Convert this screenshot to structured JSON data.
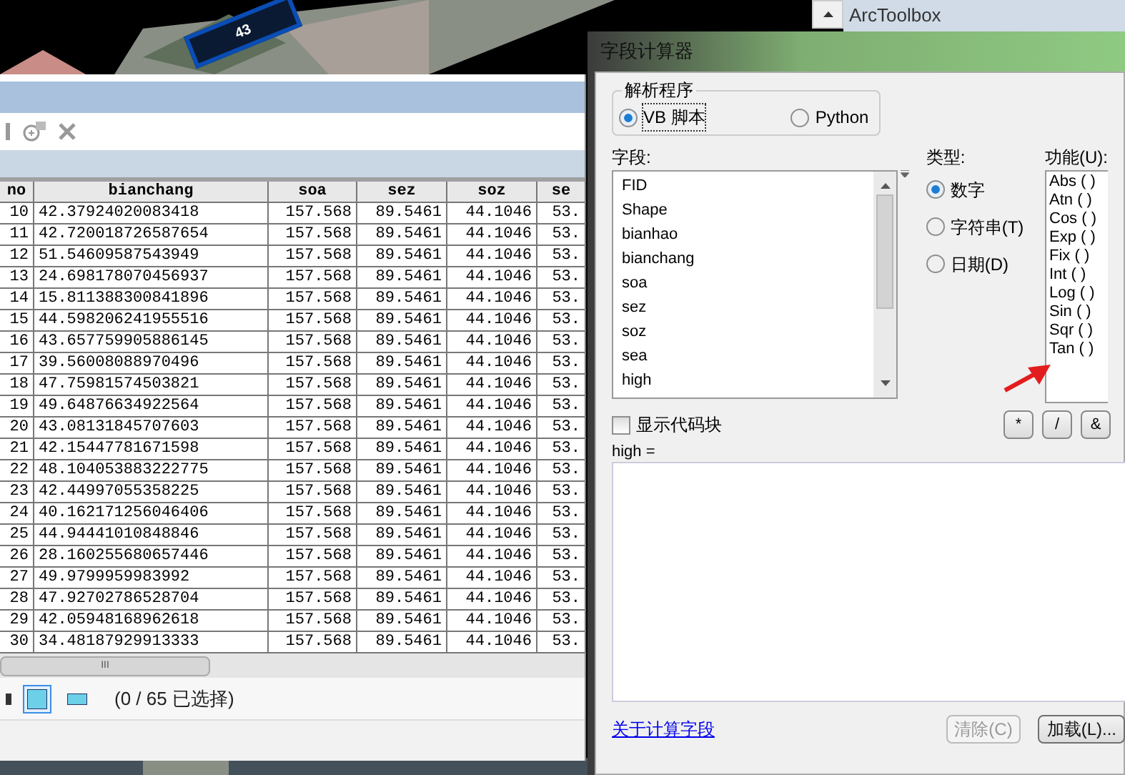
{
  "map_label": "43",
  "toolbox": {
    "title": "ArcToolbox"
  },
  "table": {
    "columns": [
      "no",
      "bianchang",
      "soa",
      "sez",
      "soz",
      "se"
    ],
    "rows": [
      [
        "10",
        "42.37924020083418",
        "157.568",
        "89.5461",
        "44.1046",
        "53."
      ],
      [
        "11",
        "42.720018726587654",
        "157.568",
        "89.5461",
        "44.1046",
        "53."
      ],
      [
        "12",
        "51.54609587543949",
        "157.568",
        "89.5461",
        "44.1046",
        "53."
      ],
      [
        "13",
        "24.698178070456937",
        "157.568",
        "89.5461",
        "44.1046",
        "53."
      ],
      [
        "14",
        "15.811388300841896",
        "157.568",
        "89.5461",
        "44.1046",
        "53."
      ],
      [
        "15",
        "44.598206241955516",
        "157.568",
        "89.5461",
        "44.1046",
        "53."
      ],
      [
        "16",
        "43.657759905886145",
        "157.568",
        "89.5461",
        "44.1046",
        "53."
      ],
      [
        "17",
        "39.56008088970496",
        "157.568",
        "89.5461",
        "44.1046",
        "53."
      ],
      [
        "18",
        "47.75981574503821",
        "157.568",
        "89.5461",
        "44.1046",
        "53."
      ],
      [
        "19",
        "49.64876634922564",
        "157.568",
        "89.5461",
        "44.1046",
        "53."
      ],
      [
        "20",
        "43.08131845707603",
        "157.568",
        "89.5461",
        "44.1046",
        "53."
      ],
      [
        "21",
        "42.15447781671598",
        "157.568",
        "89.5461",
        "44.1046",
        "53."
      ],
      [
        "22",
        "48.104053883222775",
        "157.568",
        "89.5461",
        "44.1046",
        "53."
      ],
      [
        "23",
        "42.44997055358225",
        "157.568",
        "89.5461",
        "44.1046",
        "53."
      ],
      [
        "24",
        "40.162171256046406",
        "157.568",
        "89.5461",
        "44.1046",
        "53."
      ],
      [
        "25",
        "44.94441010848846",
        "157.568",
        "89.5461",
        "44.1046",
        "53."
      ],
      [
        "26",
        "28.160255680657446",
        "157.568",
        "89.5461",
        "44.1046",
        "53."
      ],
      [
        "27",
        "49.9799959983992",
        "157.568",
        "89.5461",
        "44.1046",
        "53."
      ],
      [
        "28",
        "47.92702786528704",
        "157.568",
        "89.5461",
        "44.1046",
        "53."
      ],
      [
        "29",
        "42.05948168962618",
        "157.568",
        "89.5461",
        "44.1046",
        "53."
      ],
      [
        "30",
        "34.48187929913333",
        "157.568",
        "89.5461",
        "44.1046",
        "53."
      ]
    ],
    "scrollbar_grip": "III",
    "views": [
      {
        "selected": true
      },
      {
        "selected": false
      }
    ],
    "status": "(0 / 65 已选择)"
  },
  "dialog": {
    "title": "字段计算器",
    "parser": {
      "label": "解析程序",
      "options": [
        {
          "label": "VB 脚本",
          "selected": true
        },
        {
          "label": "Python",
          "selected": false
        }
      ]
    },
    "fields": {
      "label": "字段:",
      "items": [
        "FID",
        "Shape",
        "bianhao",
        "bianchang",
        "soa",
        "sez",
        "soz",
        "sea",
        "high"
      ]
    },
    "type": {
      "label": "类型:",
      "options": [
        {
          "label": "数字",
          "selected": true
        },
        {
          "label": "字符串(T)",
          "selected": false
        },
        {
          "label": "日期(D)",
          "selected": false
        }
      ]
    },
    "functions": {
      "label": "功能(U):",
      "items": [
        "Abs ( )",
        "Atn ( )",
        "Cos ( )",
        "Exp ( )",
        "Fix ( )",
        "Int ( )",
        "Log ( )",
        "Sin ( )",
        "Sqr ( )",
        "Tan ( )"
      ]
    },
    "show_codeblock": {
      "label": "显示代码块",
      "checked": false
    },
    "operators": [
      "*",
      "/",
      "&"
    ],
    "expression_label": "high =",
    "help_link": "关于计算字段",
    "buttons": [
      {
        "label": "清除(C)",
        "disabled": true
      },
      {
        "label": "加载(L)...",
        "disabled": false
      }
    ]
  }
}
